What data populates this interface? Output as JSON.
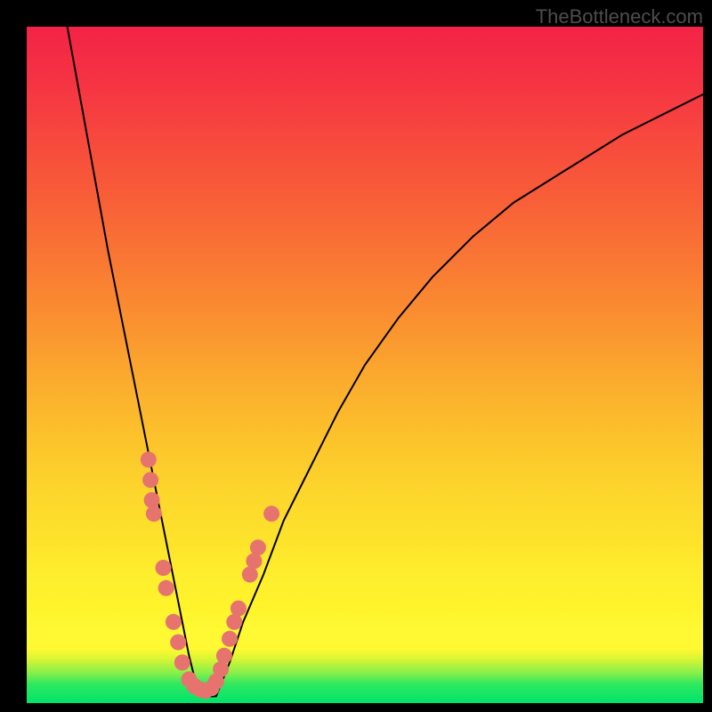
{
  "watermark": "TheBottleneck.com",
  "chart_data": {
    "type": "line",
    "title": "",
    "xlabel": "",
    "ylabel": "",
    "xlim": [
      0,
      100
    ],
    "ylim": [
      0,
      100
    ],
    "grid": false,
    "series": [
      {
        "name": "bottleneck-curve",
        "x": [
          6,
          8,
          10,
          12,
          14,
          16,
          18,
          20,
          21,
          22,
          23,
          24,
          25,
          26,
          28,
          30,
          32,
          35,
          38,
          42,
          46,
          50,
          55,
          60,
          66,
          72,
          80,
          88,
          96,
          100
        ],
        "y": [
          100,
          89,
          78,
          67,
          57,
          47,
          37,
          27,
          22,
          17,
          12,
          7,
          3,
          1,
          1,
          6,
          12,
          19,
          27,
          35,
          43,
          50,
          57,
          63,
          69,
          74,
          79,
          84,
          88,
          90
        ]
      }
    ],
    "markers": {
      "name": "sample-points",
      "color": "#e7736f",
      "radius": 9,
      "points": [
        {
          "x": 18.0,
          "y": 36
        },
        {
          "x": 18.3,
          "y": 33
        },
        {
          "x": 18.5,
          "y": 30
        },
        {
          "x": 18.8,
          "y": 28
        },
        {
          "x": 20.2,
          "y": 20
        },
        {
          "x": 20.6,
          "y": 17
        },
        {
          "x": 21.7,
          "y": 12
        },
        {
          "x": 22.4,
          "y": 9
        },
        {
          "x": 23.0,
          "y": 6
        },
        {
          "x": 24.0,
          "y": 3.5
        },
        {
          "x": 24.8,
          "y": 2.5
        },
        {
          "x": 25.7,
          "y": 2
        },
        {
          "x": 26.4,
          "y": 1.8
        },
        {
          "x": 27.3,
          "y": 2.2
        },
        {
          "x": 28.0,
          "y": 3.2
        },
        {
          "x": 28.7,
          "y": 5
        },
        {
          "x": 29.2,
          "y": 7
        },
        {
          "x": 30.0,
          "y": 9.5
        },
        {
          "x": 30.7,
          "y": 12
        },
        {
          "x": 31.3,
          "y": 14
        },
        {
          "x": 33.0,
          "y": 19
        },
        {
          "x": 33.6,
          "y": 21
        },
        {
          "x": 34.2,
          "y": 23
        },
        {
          "x": 36.2,
          "y": 28
        }
      ]
    },
    "background_gradient": {
      "top": "#f42346",
      "mid": "#fef932",
      "bottom": "#00e46b"
    }
  }
}
